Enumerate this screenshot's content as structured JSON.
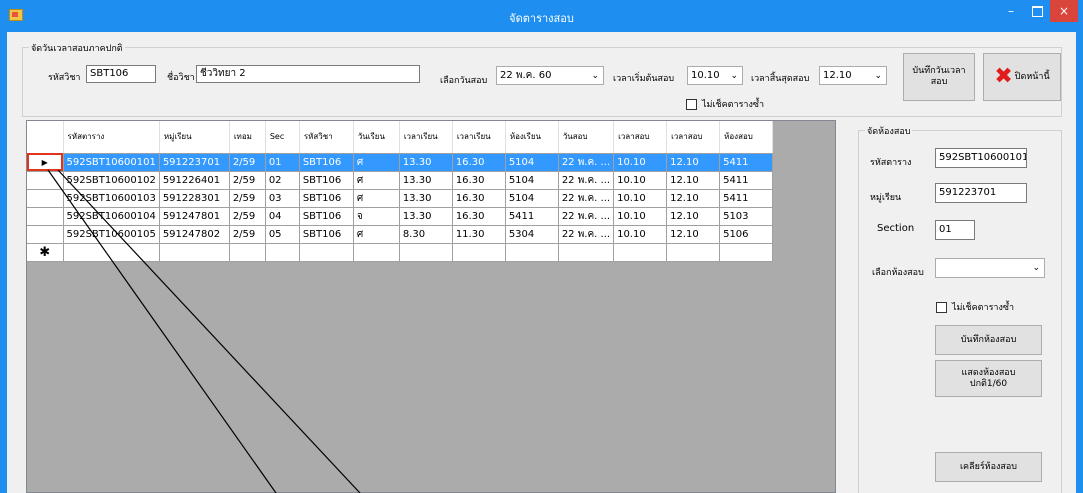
{
  "window": {
    "title": "จัดตารางสอบ",
    "min": "–",
    "close": "×"
  },
  "exam_date": {
    "group_label": "จัดวันเวลาสอบภาคปกติ",
    "subject_code_label": "รหัสวิชา",
    "subject_code_value": "SBT106",
    "subject_name_label": "ชื่อวิชา",
    "subject_name_value": "ชีววิทยา 2",
    "date_label": "เลือกวันสอบ",
    "date_value": "22 พ.ค. 60",
    "start_label": "เวลาเริ่มต้นสอบ",
    "start_value": "10.10",
    "end_label": "เวลาสิ้นสุดสอบ",
    "end_value": "12.10",
    "no_check_label": "ไม่เช็คตารางซ้ำ",
    "save_button": "บันทึกวันเวลาสอบ",
    "close_button": "ปิดหน้านี้"
  },
  "grid": {
    "columns": [
      "รหัสตาราง",
      "หมู่เรียน",
      "เทอม",
      "Sec",
      "รหัสวิชา",
      "วันเรียน",
      "เวลาเรียน",
      "เวลาเรียน",
      "ห้องเรียน",
      "วันสอบ",
      "เวลาสอบ",
      "เวลาสอบ",
      "ห้องสอบ"
    ],
    "rows": [
      [
        "592SBT10600101",
        "591223701",
        "2/59",
        "01",
        "SBT106",
        "ศ",
        "13.30",
        "16.30",
        "5104",
        "22 พ.ค. ...",
        "10.10",
        "12.10",
        "5411"
      ],
      [
        "592SBT10600102",
        "591226401",
        "2/59",
        "02",
        "SBT106",
        "ศ",
        "13.30",
        "16.30",
        "5104",
        "22 พ.ค. ...",
        "10.10",
        "12.10",
        "5411"
      ],
      [
        "592SBT10600103",
        "591228301",
        "2/59",
        "03",
        "SBT106",
        "ศ",
        "13.30",
        "16.30",
        "5104",
        "22 พ.ค. ...",
        "10.10",
        "12.10",
        "5411"
      ],
      [
        "592SBT10600104",
        "591247801",
        "2/59",
        "04",
        "SBT106",
        "จ",
        "13.30",
        "16.30",
        "5411",
        "22 พ.ค. ...",
        "10.10",
        "12.10",
        "5103"
      ],
      [
        "592SBT10600105",
        "591247802",
        "2/59",
        "05",
        "SBT106",
        "ศ",
        "8.30",
        "11.30",
        "5304",
        "22 พ.ค. ...",
        "10.10",
        "12.10",
        "5106"
      ]
    ],
    "selected_row": 0,
    "row_pointer": "▶",
    "new_row_symbol": "✱"
  },
  "room": {
    "group_label": "จัดห้องสอบ",
    "table_code_label": "รหัสตาราง",
    "table_code_value": "592SBT10600101",
    "section_group_label": "หมู่เรียน",
    "section_group_value": "591223701",
    "section_label": "Section",
    "section_value": "01",
    "room_label": "เลือกห้องสอบ",
    "room_value": "",
    "no_check_label": "ไม่เช็คตารางซ้ำ",
    "save_button": "บันทึกห้องสอบ",
    "show_button": "แสดงห้องสอบปกติ1/60",
    "clear_button": "เคลียร์ห้องสอบ"
  },
  "colors": {
    "titlebar": "#1e8ff0",
    "selection": "#3399ff",
    "highlight": "#e0341c"
  }
}
